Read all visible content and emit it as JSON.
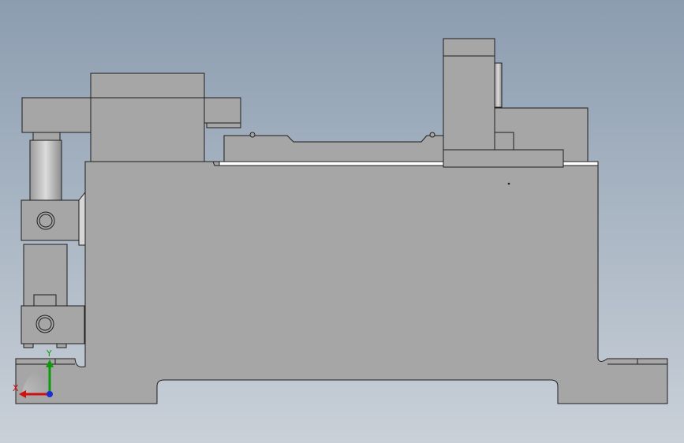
{
  "viewport": {
    "background_top": "#8c9db0",
    "background_bottom": "#c9d0d8"
  },
  "model": {
    "body_color": "#a6a6a6",
    "edge_color": "#1e1e1e",
    "highlight_color": "#ffffff",
    "rod_color": "#c8c8c8"
  },
  "triad": {
    "x_label": "X",
    "y_label": "Y",
    "x_color": "#d01010",
    "y_color": "#0d9a0d",
    "z_color": "#1a2fd0"
  }
}
